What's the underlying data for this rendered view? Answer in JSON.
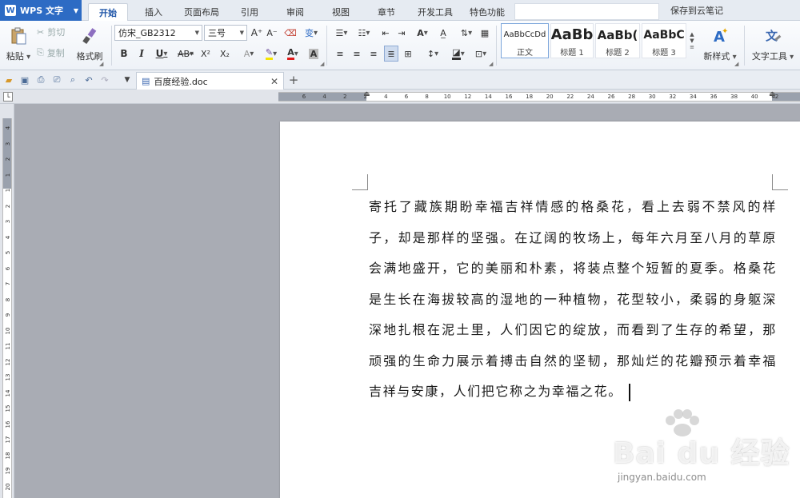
{
  "app": {
    "name": "WPS 文字"
  },
  "menu_tabs": [
    "开始",
    "插入",
    "页面布局",
    "引用",
    "审阅",
    "视图",
    "章节",
    "开发工具",
    "特色功能"
  ],
  "cloud_save": "保存到云笔记",
  "ribbon": {
    "paste": "粘贴",
    "cut": "剪切",
    "copy": "复制",
    "format_painter": "格式刷",
    "font_name": "仿宋_GB2312",
    "font_size": "三号",
    "bold": "B",
    "italic": "I",
    "underline": "U",
    "strike": "AB",
    "superscript": "X²",
    "subscript": "X₂",
    "styles": [
      {
        "sample": "AaBbCcDd",
        "name": "正文"
      },
      {
        "sample": "AaBb",
        "name": "标题 1"
      },
      {
        "sample": "AaBb(",
        "name": "标题 2"
      },
      {
        "sample": "AaBbC",
        "name": "标题 3"
      }
    ],
    "new_style": "新样式",
    "text_tools": "文字工具",
    "phonetic": "变"
  },
  "document": {
    "tab_name": "百度经验.doc",
    "content": "寄托了藏族期盼幸福吉祥情感的格桑花，看上去弱不禁风的样子，却是那样的坚强。在辽阔的牧场上，每年六月至八月的草原会满地盛开，它的美丽和朴素，将装点整个短暂的夏季。格桑花是生长在海拔较高的湿地的一种植物，花型较小，柔弱的身躯深深地扎根在泥土里，人们因它的绽放，而看到了生存的希望，那顽强的生命力展示着搏击自然的坚韧，那灿烂的花瓣预示着幸福吉祥与安康，人们把它称之为幸福之花。"
  },
  "rulers": {
    "horizontal": [
      "6",
      "4",
      "2",
      "2",
      "4",
      "6",
      "8",
      "10",
      "12",
      "14",
      "16",
      "18",
      "20",
      "22",
      "24",
      "26",
      "28",
      "30",
      "32",
      "34",
      "36",
      "38",
      "40",
      "42"
    ],
    "vertical": [
      "4",
      "3",
      "2",
      "1",
      "1",
      "2",
      "3",
      "4",
      "5",
      "6",
      "7",
      "8",
      "9",
      "10",
      "11",
      "12",
      "13",
      "14",
      "15",
      "16",
      "17",
      "18",
      "19",
      "20"
    ]
  },
  "watermark": {
    "logo": "Bai du 经验",
    "url": "jingyan.baidu.com"
  },
  "colors": {
    "accent": "#2d6bc4",
    "ribbon_bg": "#eef2f7",
    "canvas_bg": "#a9acb4",
    "page_bg": "#ffffff"
  }
}
